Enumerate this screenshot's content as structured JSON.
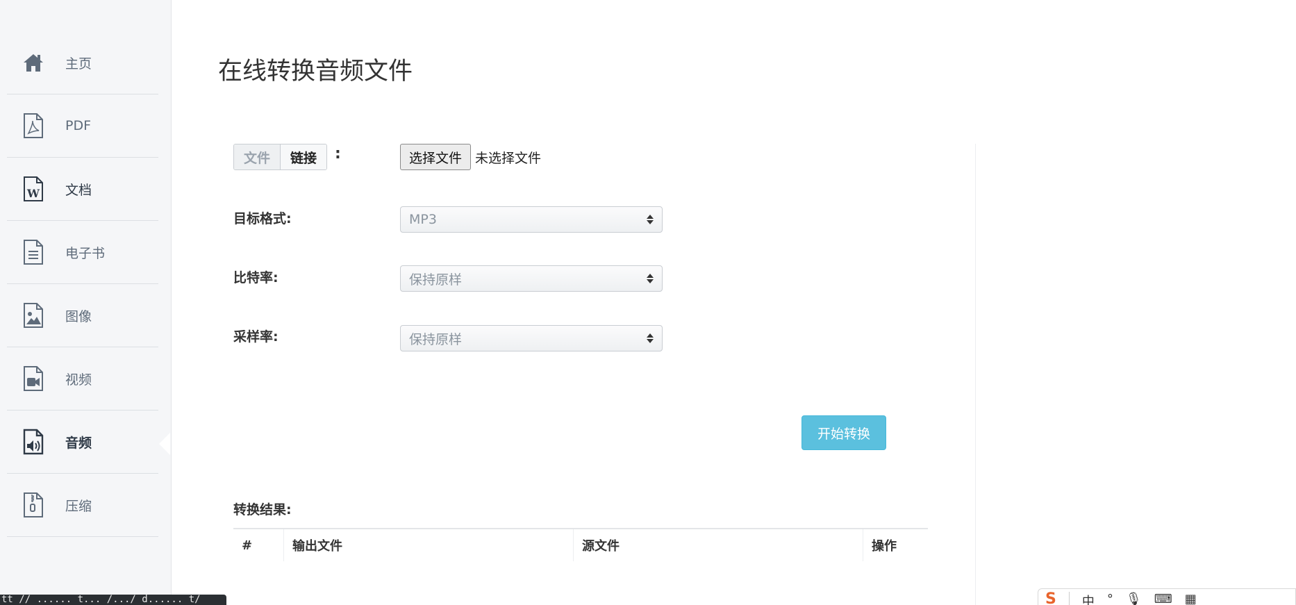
{
  "sidebar": {
    "items": [
      {
        "label": "主页",
        "icon": "home-icon"
      },
      {
        "label": "PDF",
        "icon": "pdf-file-icon"
      },
      {
        "label": "文档",
        "icon": "word-file-icon"
      },
      {
        "label": "电子书",
        "icon": "ebook-file-icon"
      },
      {
        "label": "图像",
        "icon": "image-file-icon"
      },
      {
        "label": "视频",
        "icon": "video-file-icon"
      },
      {
        "label": "音频",
        "icon": "audio-file-icon",
        "active": true
      },
      {
        "label": "压缩",
        "icon": "archive-file-icon"
      }
    ]
  },
  "main": {
    "title": "在线转换音频文件",
    "source_toggle": {
      "options": [
        "文件",
        "链接"
      ],
      "selected": "文件",
      "colon": ":"
    },
    "file_input": {
      "button_label": "选择文件",
      "status": "未选择文件"
    },
    "fields": [
      {
        "label": "目标格式:",
        "value": "MP3"
      },
      {
        "label": "比特率:",
        "value": "保持原样"
      },
      {
        "label": "采样率:",
        "value": "保持原样"
      }
    ],
    "start_button": "开始转换",
    "results": {
      "label": "转换结果:",
      "columns": [
        "#",
        "输出文件",
        "源文件",
        "操作"
      ]
    }
  },
  "status_bar": {
    "url": "tt // ...... t... /.../ d...... t/"
  },
  "ime_bar": {
    "logo": "S",
    "mode": "中",
    "items": [
      "°",
      "🎙",
      "⌨",
      "▦"
    ]
  },
  "colors": {
    "sidebar_bg": "#f5f6f8",
    "start_button": "#5bc0de",
    "text": "#333333",
    "muted_text": "#5e6b7a"
  }
}
